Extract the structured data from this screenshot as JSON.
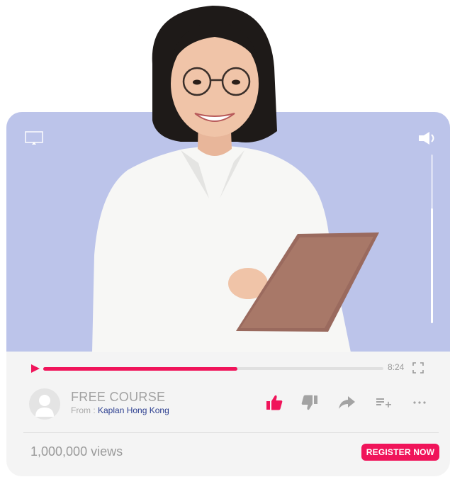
{
  "player": {
    "progress_fraction": 0.57,
    "volume_fraction": 0.68,
    "duration": "8:24"
  },
  "video": {
    "title": "FREE COURSE",
    "from_prefix": "From : ",
    "channel": "Kaplan Hong Kong",
    "views": "1,000,000 views",
    "register_label": "REGISTER NOW"
  },
  "icons": {
    "cast": "cast-icon",
    "volume": "volume-icon",
    "play": "play-icon",
    "fullscreen": "fullscreen-icon",
    "like": "thumbs-up-icon",
    "dislike": "thumbs-down-icon",
    "share": "share-icon",
    "playlist": "add-to-playlist-icon",
    "more": "more-icon",
    "avatar": "user-avatar-icon"
  },
  "colors": {
    "accent": "#f0145a",
    "video_background": "#bcc4ea",
    "channel_link": "#2a3d8f",
    "card_background": "#f4f4f4"
  }
}
